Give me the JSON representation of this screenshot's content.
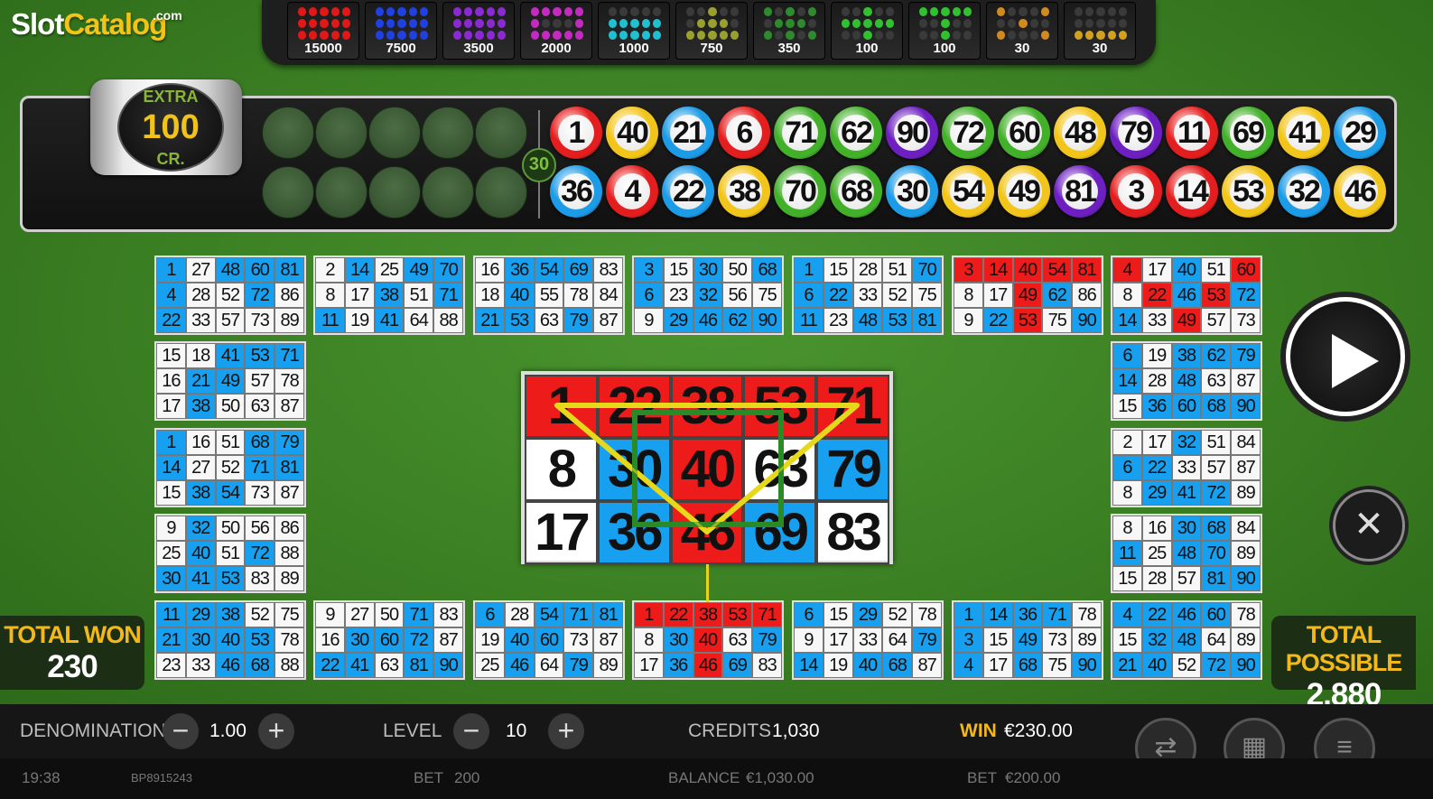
{
  "logo": {
    "part1": "Slot",
    "part2": "Catalog",
    "suffix": ".com"
  },
  "paytable": [
    {
      "value": "15000",
      "color": "#e01818",
      "pattern": [
        1,
        1,
        1,
        1,
        1,
        1,
        1,
        1,
        1,
        1,
        1,
        1,
        1,
        1,
        1
      ]
    },
    {
      "value": "7500",
      "color": "#2040e0",
      "pattern": [
        1,
        1,
        1,
        1,
        1,
        1,
        1,
        1,
        1,
        1,
        1,
        1,
        1,
        1,
        1
      ]
    },
    {
      "value": "3500",
      "color": "#8a2ad0",
      "pattern": [
        1,
        1,
        1,
        1,
        1,
        1,
        1,
        1,
        1,
        1,
        1,
        1,
        1,
        1,
        1
      ]
    },
    {
      "value": "2000",
      "color": "#c22ac0",
      "pattern": [
        1,
        1,
        1,
        1,
        1,
        1,
        0,
        0,
        0,
        1,
        1,
        1,
        1,
        1,
        1
      ]
    },
    {
      "value": "1000",
      "color": "#20c0d0",
      "pattern": [
        0,
        0,
        0,
        0,
        0,
        1,
        1,
        1,
        1,
        1,
        1,
        1,
        1,
        1,
        1
      ]
    },
    {
      "value": "750",
      "color": "#9aa030",
      "pattern": [
        0,
        0,
        1,
        0,
        0,
        0,
        1,
        1,
        1,
        0,
        1,
        1,
        1,
        1,
        1
      ]
    },
    {
      "value": "350",
      "color": "#2f8a2f",
      "pattern": [
        1,
        0,
        1,
        0,
        1,
        0,
        1,
        1,
        1,
        0,
        1,
        0,
        1,
        0,
        1
      ]
    },
    {
      "value": "100",
      "color": "#30c030",
      "pattern": [
        0,
        0,
        1,
        0,
        0,
        1,
        1,
        1,
        1,
        1,
        0,
        0,
        1,
        0,
        0
      ]
    },
    {
      "value": "100",
      "color": "#30c030",
      "pattern": [
        1,
        1,
        1,
        1,
        1,
        0,
        0,
        1,
        0,
        0,
        0,
        0,
        1,
        0,
        0
      ]
    },
    {
      "value": "30",
      "color": "#d08a20",
      "pattern": [
        1,
        0,
        0,
        0,
        1,
        0,
        0,
        1,
        0,
        0,
        1,
        0,
        0,
        0,
        1
      ]
    },
    {
      "value": "30",
      "color": "#d0a020",
      "pattern": [
        0,
        0,
        0,
        0,
        0,
        0,
        0,
        0,
        0,
        0,
        1,
        1,
        1,
        1,
        1
      ]
    }
  ],
  "extra": {
    "label_top": "EXTRA",
    "amount": "100",
    "label_bottom": "CR."
  },
  "ball_count": "30",
  "drawn_balls": [
    {
      "n": "1",
      "c": "#e41e1e"
    },
    {
      "n": "40",
      "c": "#f2c51a"
    },
    {
      "n": "21",
      "c": "#1c9be6"
    },
    {
      "n": "6",
      "c": "#e41e1e"
    },
    {
      "n": "71",
      "c": "#43b02a"
    },
    {
      "n": "62",
      "c": "#43b02a"
    },
    {
      "n": "90",
      "c": "#6d1fc1"
    },
    {
      "n": "72",
      "c": "#43b02a"
    },
    {
      "n": "60",
      "c": "#43b02a"
    },
    {
      "n": "48",
      "c": "#f2c51a"
    },
    {
      "n": "79",
      "c": "#6d1fc1"
    },
    {
      "n": "11",
      "c": "#e41e1e"
    },
    {
      "n": "69",
      "c": "#43b02a"
    },
    {
      "n": "41",
      "c": "#f2c51a"
    },
    {
      "n": "29",
      "c": "#1c9be6"
    },
    {
      "n": "36",
      "c": "#1c9be6"
    },
    {
      "n": "4",
      "c": "#e41e1e"
    },
    {
      "n": "22",
      "c": "#1c9be6"
    },
    {
      "n": "38",
      "c": "#f2c51a"
    },
    {
      "n": "70",
      "c": "#43b02a"
    },
    {
      "n": "68",
      "c": "#43b02a"
    },
    {
      "n": "30",
      "c": "#1c9be6"
    },
    {
      "n": "54",
      "c": "#f2c51a"
    },
    {
      "n": "49",
      "c": "#f2c51a"
    },
    {
      "n": "81",
      "c": "#6d1fc1"
    },
    {
      "n": "3",
      "c": "#e41e1e"
    },
    {
      "n": "14",
      "c": "#e41e1e"
    },
    {
      "n": "53",
      "c": "#f2c51a"
    },
    {
      "n": "32",
      "c": "#1c9be6"
    },
    {
      "n": "46",
      "c": "#f2c51a"
    }
  ],
  "cards": [
    {
      "id": "c1",
      "nums": [
        "1",
        "27",
        "48",
        "60",
        "81",
        "4",
        "28",
        "52",
        "72",
        "86",
        "22",
        "33",
        "57",
        "73",
        "89"
      ],
      "marks": "bwbbb bwwbw bwwww"
    },
    {
      "id": "c2",
      "nums": [
        "2",
        "14",
        "25",
        "49",
        "70",
        "8",
        "17",
        "38",
        "51",
        "71",
        "11",
        "19",
        "41",
        "64",
        "88"
      ],
      "marks": "wbwbb wwbwb bwbww"
    },
    {
      "id": "c3",
      "nums": [
        "16",
        "36",
        "54",
        "69",
        "83",
        "18",
        "40",
        "55",
        "78",
        "84",
        "21",
        "53",
        "63",
        "79",
        "87"
      ],
      "marks": "wbbbw wbwww bbwbw"
    },
    {
      "id": "c4",
      "nums": [
        "3",
        "15",
        "30",
        "50",
        "68",
        "6",
        "23",
        "32",
        "56",
        "75",
        "9",
        "29",
        "46",
        "62",
        "90"
      ],
      "marks": "bwbwb bwbww wbbbb"
    },
    {
      "id": "c5",
      "nums": [
        "1",
        "15",
        "28",
        "51",
        "70",
        "6",
        "22",
        "33",
        "52",
        "75",
        "11",
        "23",
        "48",
        "53",
        "81"
      ],
      "marks": "bwwwb bbwww bwbbb"
    },
    {
      "id": "c6",
      "nums": [
        "3",
        "14",
        "40",
        "54",
        "81",
        "8",
        "17",
        "49",
        "62",
        "86",
        "9",
        "22",
        "53",
        "75",
        "90"
      ],
      "marks": "rrrrr wwrbw wbrwb"
    },
    {
      "id": "c7",
      "nums": [
        "4",
        "17",
        "40",
        "51",
        "60",
        "8",
        "22",
        "46",
        "53",
        "72",
        "14",
        "33",
        "49",
        "57",
        "73"
      ],
      "marks": "rwbwr wrbrb bwrww"
    },
    {
      "id": "c8",
      "nums": [
        "15",
        "18",
        "41",
        "53",
        "71",
        "16",
        "21",
        "49",
        "57",
        "78",
        "17",
        "38",
        "50",
        "63",
        "87"
      ],
      "marks": "wwbbb wbbww wbwww"
    },
    {
      "id": "c9",
      "nums": [
        "6",
        "19",
        "38",
        "62",
        "79",
        "14",
        "28",
        "48",
        "63",
        "87",
        "15",
        "36",
        "60",
        "68",
        "90"
      ],
      "marks": "bwbbb bwbww wbbbb"
    },
    {
      "id": "c10",
      "nums": [
        "1",
        "16",
        "51",
        "68",
        "79",
        "14",
        "27",
        "52",
        "71",
        "81",
        "15",
        "38",
        "54",
        "73",
        "87"
      ],
      "marks": "bwwbb bwwbb wbbww"
    },
    {
      "id": "c11",
      "nums": [
        "2",
        "17",
        "32",
        "51",
        "84",
        "6",
        "22",
        "33",
        "57",
        "87",
        "8",
        "29",
        "41",
        "72",
        "89"
      ],
      "marks": "wwbww bbwww wbbbw"
    },
    {
      "id": "c12",
      "nums": [
        "9",
        "32",
        "50",
        "56",
        "86",
        "25",
        "40",
        "51",
        "72",
        "88",
        "30",
        "41",
        "53",
        "83",
        "89"
      ],
      "marks": "wbwww wbwbw bbbww"
    },
    {
      "id": "c13",
      "nums": [
        "8",
        "16",
        "30",
        "68",
        "84",
        "11",
        "25",
        "48",
        "70",
        "89",
        "15",
        "28",
        "57",
        "81",
        "90"
      ],
      "marks": "wwbbw bwbbw wwwbb"
    },
    {
      "id": "c14",
      "nums": [
        "11",
        "29",
        "38",
        "52",
        "75",
        "21",
        "30",
        "40",
        "53",
        "78",
        "23",
        "33",
        "46",
        "68",
        "88"
      ],
      "marks": "bbbww bbbbw wwbbw"
    },
    {
      "id": "c15",
      "nums": [
        "9",
        "27",
        "50",
        "71",
        "83",
        "16",
        "30",
        "60",
        "72",
        "87",
        "22",
        "41",
        "63",
        "81",
        "90"
      ],
      "marks": "wwwbw wbbbw bbwbb"
    },
    {
      "id": "c16",
      "nums": [
        "6",
        "28",
        "54",
        "71",
        "81",
        "19",
        "40",
        "60",
        "73",
        "87",
        "25",
        "46",
        "64",
        "79",
        "89"
      ],
      "marks": "bwbbb wbbww wbwbw"
    },
    {
      "id": "c17",
      "nums": [
        "1",
        "22",
        "38",
        "53",
        "71",
        "8",
        "30",
        "40",
        "63",
        "79",
        "17",
        "36",
        "46",
        "69",
        "83"
      ],
      "marks": "rrrrr wbrwb wbrbw"
    },
    {
      "id": "c18",
      "nums": [
        "6",
        "15",
        "29",
        "52",
        "78",
        "9",
        "17",
        "33",
        "64",
        "79",
        "14",
        "19",
        "40",
        "68",
        "87"
      ],
      "marks": "bwbww wwwwb bwbbw"
    },
    {
      "id": "c19",
      "nums": [
        "1",
        "14",
        "36",
        "71",
        "78",
        "3",
        "15",
        "49",
        "73",
        "89",
        "4",
        "17",
        "68",
        "75",
        "90"
      ],
      "marks": "bbbbw bwbww bwbwb"
    },
    {
      "id": "c20",
      "nums": [
        "4",
        "22",
        "46",
        "60",
        "78",
        "15",
        "32",
        "48",
        "64",
        "89",
        "21",
        "40",
        "52",
        "72",
        "90"
      ],
      "marks": "bbbbw wbbww bbwbb"
    }
  ],
  "big_card": {
    "nums": [
      "1",
      "22",
      "38",
      "53",
      "71",
      "8",
      "30",
      "40",
      "63",
      "79",
      "17",
      "36",
      "46",
      "69",
      "83"
    ],
    "marks": "rrrrr wbrwb wbrbw"
  },
  "total_won": {
    "label": "TOTAL WON",
    "value": "230"
  },
  "total_possible": {
    "label": "TOTAL POSSIBLE",
    "value": "2,880"
  },
  "controls": {
    "denomination_label": "DENOMINATION",
    "denomination_value": "1.00",
    "level_label": "LEVEL",
    "level_value": "10",
    "credits_label": "CREDITS",
    "credits_value": "1,030",
    "win_label": "WIN",
    "win_value": "€230.00",
    "minus": "−",
    "plus": "+"
  },
  "status": {
    "time": "19:38",
    "id": "BP8915243",
    "bet_label": "BET",
    "bet_value": "200",
    "balance_label": "BALANCE",
    "balance_value": "€1,030.00",
    "bet2_label": "BET",
    "bet2_value": "€200.00"
  },
  "icons": {
    "play": "play-icon",
    "close": "close-icon",
    "cards": "cards-swap-icon",
    "grid": "keypad-icon",
    "menu": "menu-icon"
  }
}
